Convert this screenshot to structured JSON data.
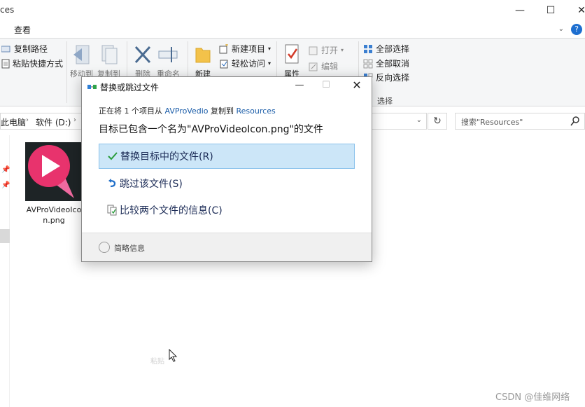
{
  "window": {
    "title_fragment": "ces",
    "minimize": "—",
    "maximize": "☐",
    "close": "✕"
  },
  "ribbon_tabs": {
    "view": "查看",
    "collapse": "⌄",
    "help": "?"
  },
  "ribbon": {
    "copy_path": "复制路径",
    "paste_shortcut": "粘贴快捷方式",
    "move_to": "移动到",
    "copy_to": "复制到",
    "delete": "删除",
    "rename": "重命名",
    "new_folder": "新建",
    "new_item": "新建项目",
    "easy_access": "轻松访问",
    "properties": "属性",
    "open": "打开",
    "edit": "编辑",
    "select_all": "全部选择",
    "select_none": "全部取消",
    "invert_selection": "反向选择",
    "select_group": "选择"
  },
  "address": {
    "crumb_pc": "此电脑",
    "crumb_drive": "软件 (D:)",
    "refresh": "↻",
    "search_placeholder": "搜索\"Resources\""
  },
  "files": [
    {
      "name": "AVProVideoIcon.png",
      "name_line1": "AVProVideoIco",
      "name_line2": "n.png"
    }
  ],
  "faint_text": "粘贴",
  "watermark": "CSDN @佳维网络",
  "dialog": {
    "title": "替换或跳过文件",
    "minimize": "—",
    "maximize": "☐",
    "close": "✕",
    "line1_prefix": "正在将 1 个项目从",
    "source": "AVProVedio",
    "line1_middle": "复制到",
    "destination": "Resources",
    "message": "目标已包含一个名为\"AVProVideoIcon.png\"的文件",
    "option_replace": "替换目标中的文件(R)",
    "option_skip": "跳过该文件(S)",
    "option_compare": "比较两个文件的信息(C)",
    "footer_toggle": "简略信息"
  },
  "colors": {
    "accent": "#1a5ca8",
    "selected_option_bg": "#cce6f8",
    "check_green": "#2a9d3c",
    "icon_pink": "#e8336d"
  }
}
